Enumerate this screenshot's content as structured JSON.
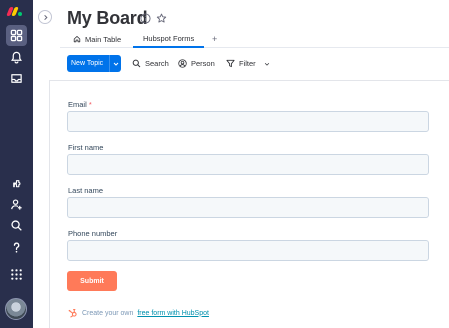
{
  "rail": {
    "items": [
      {
        "name": "board-icon"
      },
      {
        "name": "notifications-icon"
      },
      {
        "name": "inbox-icon"
      },
      {
        "name": "apps-icon"
      },
      {
        "name": "invite-icon"
      },
      {
        "name": "search-icon"
      },
      {
        "name": "help-icon"
      },
      {
        "name": "apps-grid-icon"
      }
    ]
  },
  "header": {
    "title": "My Board"
  },
  "tabs": [
    {
      "label": "Main Table"
    },
    {
      "label": "Hubspot Forms"
    },
    {
      "label": "+"
    }
  ],
  "toolbar": {
    "new_topic": "New Topic",
    "search": "Search",
    "person": "Person",
    "filter": "Filter"
  },
  "form": {
    "fields": [
      {
        "label": "Email",
        "required_mark": "*",
        "value": ""
      },
      {
        "label": "First name",
        "value": ""
      },
      {
        "label": "Last name",
        "value": ""
      },
      {
        "label": "Phone number",
        "value": ""
      }
    ],
    "submit_label": "Submit",
    "promo_text": "Create your own",
    "promo_link": "free form with HubSpot"
  },
  "colors": {
    "rail": "#292f4c",
    "accent": "#0073ea",
    "submit": "#ff7a59"
  }
}
